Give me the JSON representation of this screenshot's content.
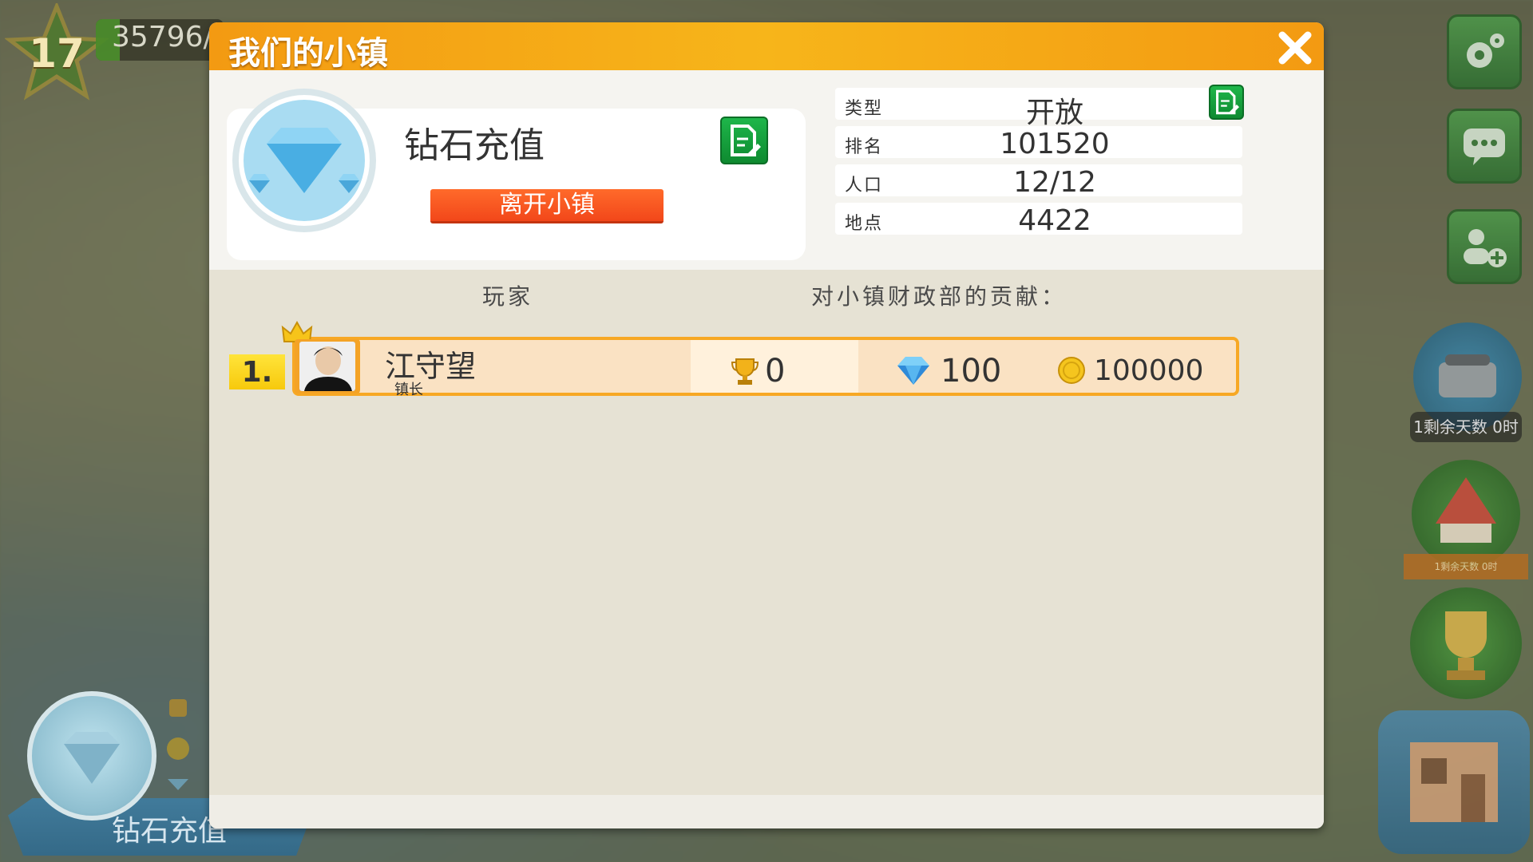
{
  "hud": {
    "level": "17",
    "xp_text": "35796/"
  },
  "background": {
    "town_badge_name": "钻石充值",
    "event_timer_label": "1剩余天数 0时",
    "circus_ribbon_label": "1剩余天数 0时"
  },
  "dialog": {
    "title": "我们的小镇",
    "town_name": "钻石充值",
    "leave_button": "离开小镇",
    "info": [
      {
        "label": "类型",
        "value": "开放"
      },
      {
        "label": "排名",
        "value": "101520"
      },
      {
        "label": "人口",
        "value": "12/12"
      },
      {
        "label": "地点",
        "value": "4422"
      }
    ],
    "columns": {
      "player": "玩家",
      "contribution": "对小镇财政部的贡献："
    },
    "members": [
      {
        "rank": "1.",
        "name": "江守望",
        "role": "镇长",
        "trophies": "0",
        "diamonds": "100",
        "coins": "100000"
      }
    ]
  },
  "colors": {
    "header_orange": "#f39a12",
    "leave_red": "#f2471a",
    "edit_green": "#1eb64a",
    "row_border": "#f7a824"
  }
}
